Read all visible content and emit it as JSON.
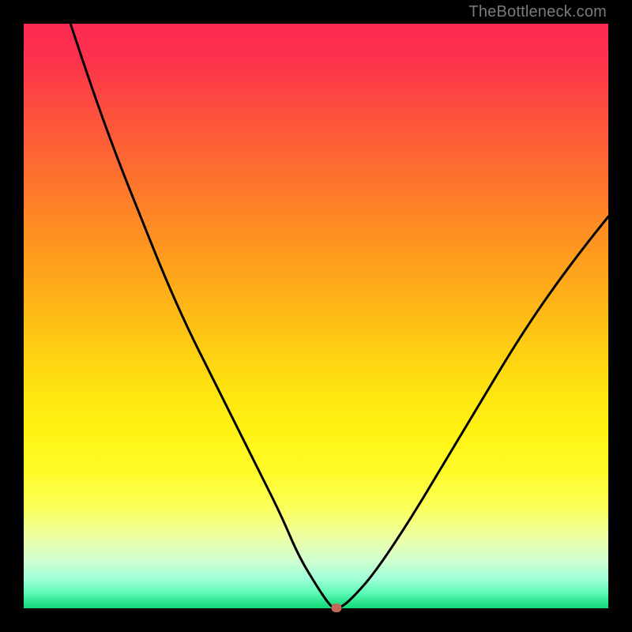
{
  "attribution": "TheBottleneck.com",
  "chart_data": {
    "type": "line",
    "title": "",
    "xlabel": "",
    "ylabel": "",
    "xlim": [
      0,
      100
    ],
    "ylim": [
      0,
      100
    ],
    "grid": false,
    "legend": false,
    "series": [
      {
        "name": "curve",
        "x": [
          8,
          12,
          16,
          20,
          24,
          28,
          32,
          36,
          40,
          44,
          47,
          50,
          52,
          53,
          54,
          56,
          60,
          66,
          72,
          78,
          84,
          90,
          96,
          100
        ],
        "values": [
          100,
          88,
          77,
          67,
          57,
          48,
          40,
          32,
          24,
          16,
          9,
          4,
          1,
          0,
          0,
          1.5,
          6,
          15,
          25,
          35,
          45,
          54,
          62,
          67
        ]
      }
    ],
    "marker": {
      "x": 53.5,
      "y": 0,
      "color": "#c1675b"
    },
    "colors": {
      "top": "#fd2a53",
      "mid": "#fff313",
      "bottom": "#15d87c",
      "curve": "#000000",
      "marker": "#c1675b",
      "frame": "#000000"
    }
  }
}
